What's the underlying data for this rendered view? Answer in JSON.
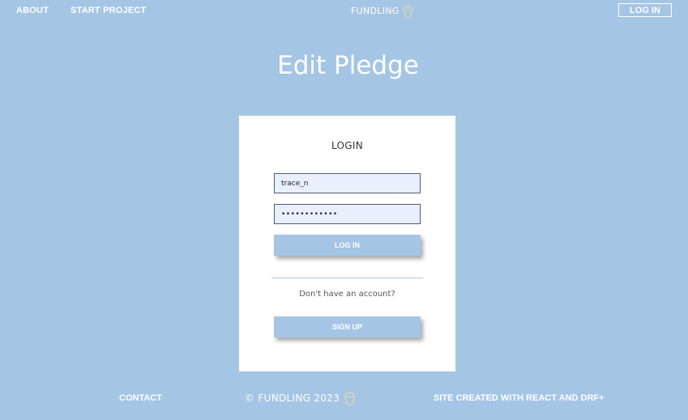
{
  "nav": {
    "about": "ABOUT",
    "start_project": "START PROJECT",
    "brand": "FUNDLING",
    "login": "LOG IN"
  },
  "page": {
    "title": "Edit Pledge"
  },
  "login_form": {
    "title": "LOGIN",
    "username_value": "trace_n",
    "password_value": "••••••••••••",
    "login_button": "LOG IN",
    "no_account_text": "Don't have an account?",
    "signup_button": "SIGN UP"
  },
  "footer": {
    "contact": "CONTACT",
    "copyright": "© FUNDLING 2023",
    "credit": "SITE CREATED WITH REACT AND DRF+"
  },
  "colors": {
    "background": "#a5c5e5",
    "card": "#ffffff",
    "input_fill": "#e8f0fe"
  },
  "icons": {
    "brand_icon": "acorn-icon"
  }
}
